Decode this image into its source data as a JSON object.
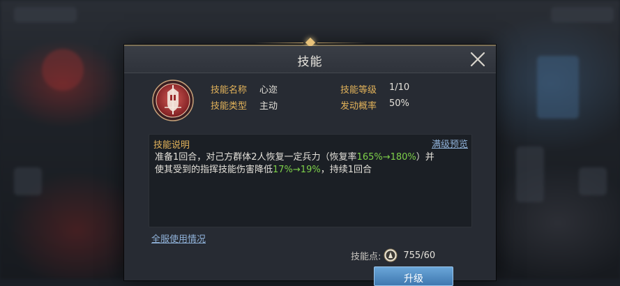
{
  "dialog": {
    "title": "技能",
    "close_icon": "close-icon"
  },
  "skill": {
    "icon": "helmet-emblem-icon",
    "name_label": "技能名称",
    "name_value": "心迩",
    "type_label": "技能类型",
    "type_value": "主动",
    "level_label": "技能等级",
    "level_value": "1/10",
    "chance_label": "发动概率",
    "chance_value": "50%"
  },
  "description": {
    "title": "技能说明",
    "preview_link": "满级预览",
    "line1_a": "准备1回合，对己方群体2人恢复一定兵力（恢复率",
    "line1_green": "165%→180%",
    "line1_b": "）并",
    "line2_a": "使其受到的指挥技能伤害降低",
    "line2_green": "17%→19%",
    "line2_b": "，持续1回合"
  },
  "server_usage_link": "全服使用情况",
  "points": {
    "label": "技能点:",
    "icon": "skill-point-coin-icon",
    "value": "755/60"
  },
  "upgrade_button": "升级",
  "colors": {
    "accent_gold": "#e3b35a",
    "highlight_green": "#7ed14a",
    "link_blue": "#8fb1d8",
    "button_blue": "#4f8cc4"
  }
}
